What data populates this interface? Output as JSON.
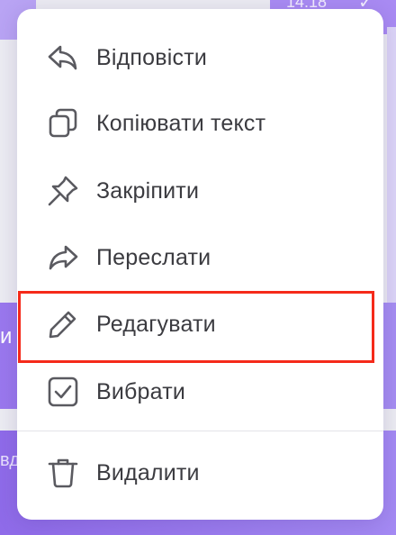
{
  "background": {
    "time": "14:18",
    "check_glyph": "✓",
    "mid_fragment": "и",
    "bottom_fragment": "вд"
  },
  "menu": {
    "items": [
      {
        "label": "Відповісти",
        "icon": "reply-icon"
      },
      {
        "label": "Копіювати текст",
        "icon": "copy-icon"
      },
      {
        "label": "Закріпити",
        "icon": "pin-icon"
      },
      {
        "label": "Переслати",
        "icon": "forward-icon"
      },
      {
        "label": "Редагувати",
        "icon": "pencil-icon"
      },
      {
        "label": "Вибрати",
        "icon": "checkbox-icon"
      },
      {
        "label": "Видалити",
        "icon": "trash-icon"
      }
    ]
  },
  "colors": {
    "highlight_border": "#f52a1a",
    "accent_purple": "#9a78ee",
    "icon_color": "#5a5a60"
  }
}
